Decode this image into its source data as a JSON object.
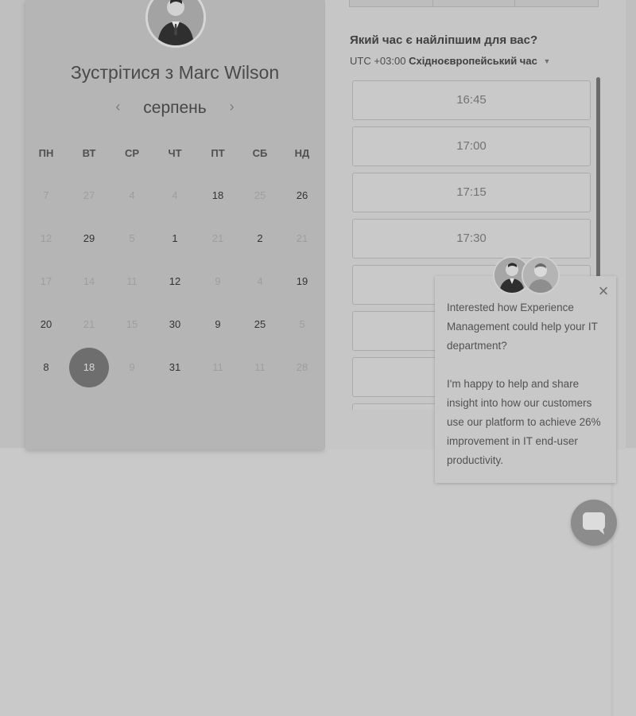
{
  "calendar": {
    "title": "Зустрітися з Marc Wilson",
    "month": "серпень",
    "weekdays": [
      "ПН",
      "ВТ",
      "СР",
      "ЧТ",
      "ПТ",
      "СБ",
      "НД"
    ],
    "weeks": [
      [
        {
          "d": "7",
          "a": false
        },
        {
          "d": "27",
          "a": false
        },
        {
          "d": "4",
          "a": false
        },
        {
          "d": "4",
          "a": false
        },
        {
          "d": "18",
          "a": true
        },
        {
          "d": "25",
          "a": false
        },
        {
          "d": "26",
          "a": true
        }
      ],
      [
        {
          "d": "12",
          "a": false
        },
        {
          "d": "29",
          "a": true
        },
        {
          "d": "5",
          "a": false
        },
        {
          "d": "1",
          "a": true
        },
        {
          "d": "21",
          "a": false
        },
        {
          "d": "2",
          "a": true
        },
        {
          "d": "21",
          "a": false
        }
      ],
      [
        {
          "d": "17",
          "a": false
        },
        {
          "d": "14",
          "a": false
        },
        {
          "d": "11",
          "a": false
        },
        {
          "d": "12",
          "a": true
        },
        {
          "d": "9",
          "a": false
        },
        {
          "d": "4",
          "a": false
        },
        {
          "d": "19",
          "a": true
        }
      ],
      [
        {
          "d": "20",
          "a": true
        },
        {
          "d": "21",
          "a": false
        },
        {
          "d": "15",
          "a": false
        },
        {
          "d": "30",
          "a": true
        },
        {
          "d": "9",
          "a": true
        },
        {
          "d": "25",
          "a": true
        },
        {
          "d": "5",
          "a": false
        }
      ],
      [
        {
          "d": "8",
          "a": true
        },
        {
          "d": "18",
          "a": true,
          "selected": true
        },
        {
          "d": "9",
          "a": false
        },
        {
          "d": "31",
          "a": true
        },
        {
          "d": "11",
          "a": false
        },
        {
          "d": "11",
          "a": false
        },
        {
          "d": "28",
          "a": false
        }
      ]
    ]
  },
  "time_panel": {
    "question": "Який час є найліпшим для вас?",
    "timezone_prefix": "UTC +03:00",
    "timezone_name": "Східноєвропейський час",
    "slots": [
      "16:45",
      "17:00",
      "17:15",
      "17:30",
      "",
      "",
      "",
      ""
    ]
  },
  "chat": {
    "paragraphs": [
      "Interested how Experience Management could help your IT department?",
      "I'm happy to help and share insight into how our customers use our platform to achieve 26% improvement in IT end-user productivity."
    ]
  },
  "icons": {
    "prev": "chevron-left-icon",
    "next": "chevron-right-icon",
    "close": "close-icon",
    "chat": "chat-bubble-icon",
    "caret": "caret-down-icon"
  }
}
